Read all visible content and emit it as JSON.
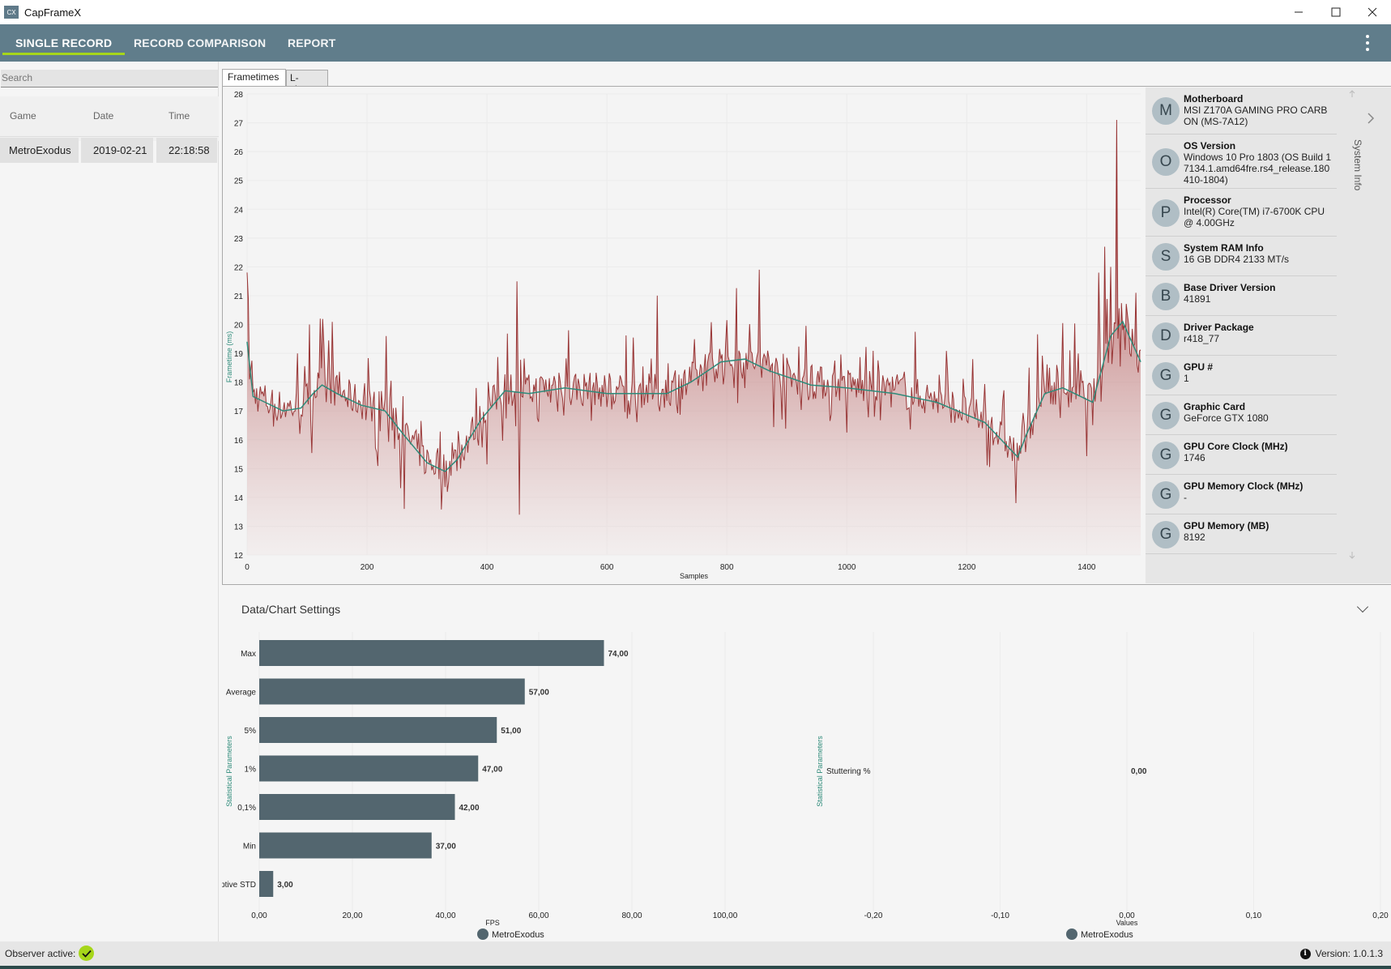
{
  "window": {
    "title": "CapFrameX",
    "icon_text": "CX",
    "controls": [
      "minimize-icon",
      "maximize-icon",
      "close-icon"
    ]
  },
  "nav": {
    "tabs": [
      {
        "label": "SINGLE RECORD",
        "active": true
      },
      {
        "label": "RECORD COMPARISON",
        "active": false
      },
      {
        "label": "REPORT",
        "active": false
      }
    ],
    "menu_icon": "kebab-menu-icon",
    "accent": "#a6d61a",
    "bar_color": "#607d8b"
  },
  "records": {
    "search_placeholder": "Search",
    "columns": [
      "Game",
      "Date",
      "Time"
    ],
    "rows": [
      {
        "game": "MetroExodus",
        "date": "2019-02-21",
        "time": "22:18:58"
      }
    ]
  },
  "chart_tabs": [
    {
      "label": "Frametimes",
      "active": true
    },
    {
      "label": "L-shape",
      "active": false
    }
  ],
  "system_info": {
    "rail_label": "System Info",
    "items": [
      {
        "initial": "M",
        "label": "Motherboard",
        "value": "MSI Z170A GAMING PRO CARBON (MS-7A12)"
      },
      {
        "initial": "O",
        "label": "OS Version",
        "value": "Windows 10 Pro 1803 (OS Build 17134.1.amd64fre.rs4_release.180410-1804)"
      },
      {
        "initial": "P",
        "label": "Processor",
        "value": "Intel(R) Core(TM) i7-6700K CPU @ 4.00GHz"
      },
      {
        "initial": "S",
        "label": "System RAM Info",
        "value": "16 GB DDR4 2133 MT/s"
      },
      {
        "initial": "B",
        "label": "Base Driver Version",
        "value": "41891"
      },
      {
        "initial": "D",
        "label": "Driver Package",
        "value": "r418_77"
      },
      {
        "initial": "G",
        "label": "GPU #",
        "value": "1"
      },
      {
        "initial": "G",
        "label": "Graphic Card",
        "value": "GeForce GTX 1080"
      },
      {
        "initial": "G",
        "label": "GPU Core Clock (MHz)",
        "value": "1746"
      },
      {
        "initial": "G",
        "label": "GPU Memory Clock (MHz)",
        "value": "-"
      },
      {
        "initial": "G",
        "label": "GPU Memory (MB)",
        "value": "8192"
      }
    ]
  },
  "settings": {
    "title": "Data/Chart Settings"
  },
  "status": {
    "observer_label": "Observer active:",
    "version_label": "Version: 1.0.1.3"
  },
  "chart_data": [
    {
      "type": "line",
      "title": "Frametimes",
      "xlabel": "Samples",
      "ylabel": "Frametime (ms)",
      "xlim": [
        0,
        1490
      ],
      "ylim": [
        12,
        28
      ],
      "xticks": [
        0,
        200,
        400,
        600,
        800,
        1000,
        1200,
        1400
      ],
      "yticks": [
        12,
        13,
        14,
        15,
        16,
        17,
        18,
        19,
        20,
        21,
        22,
        23,
        24,
        25,
        26,
        27,
        28
      ],
      "grid": true,
      "series": [
        {
          "name": "Frametime",
          "color": "#8b1a1a",
          "style": "noisy line with gradient area fill",
          "trend_points": [
            [
              0,
              19.4
            ],
            [
              10,
              17.5
            ],
            [
              30,
              17.3
            ],
            [
              60,
              17.0
            ],
            [
              90,
              17.1
            ],
            [
              110,
              17.6
            ],
            [
              125,
              17.9
            ],
            [
              150,
              17.6
            ],
            [
              190,
              17.2
            ],
            [
              230,
              17.0
            ],
            [
              260,
              16.2
            ],
            [
              300,
              15.2
            ],
            [
              330,
              14.9
            ],
            [
              350,
              15.3
            ],
            [
              390,
              16.7
            ],
            [
              430,
              17.7
            ],
            [
              470,
              17.6
            ],
            [
              530,
              17.8
            ],
            [
              600,
              17.6
            ],
            [
              700,
              17.6
            ],
            [
              740,
              18.0
            ],
            [
              790,
              18.7
            ],
            [
              830,
              18.8
            ],
            [
              870,
              18.4
            ],
            [
              940,
              17.9
            ],
            [
              1000,
              17.8
            ],
            [
              1080,
              17.6
            ],
            [
              1150,
              17.3
            ],
            [
              1230,
              16.6
            ],
            [
              1285,
              15.4
            ],
            [
              1300,
              16.2
            ],
            [
              1330,
              17.6
            ],
            [
              1360,
              17.8
            ],
            [
              1410,
              17.3
            ],
            [
              1440,
              19.6
            ],
            [
              1460,
              20.1
            ],
            [
              1490,
              18.7
            ]
          ],
          "spikes": [
            [
              3,
              20.9
            ],
            [
              105,
              20.0
            ],
            [
              232,
              19.6
            ],
            [
              450,
              21.5
            ],
            [
              685,
              21.0
            ],
            [
              855,
              21.9
            ],
            [
              1451,
              27.1
            ],
            [
              1430,
              22.7
            ],
            [
              1440,
              22.0
            ],
            [
              1420,
              21.8
            ],
            [
              455,
              13.4
            ],
            [
              262,
              13.6
            ],
            [
              1283,
              13.8
            ]
          ]
        },
        {
          "name": "Moving average",
          "color": "#2e8b7a",
          "points": [
            [
              0,
              19.4
            ],
            [
              10,
              17.5
            ],
            [
              30,
              17.3
            ],
            [
              60,
              17.0
            ],
            [
              90,
              17.1
            ],
            [
              110,
              17.6
            ],
            [
              125,
              17.9
            ],
            [
              150,
              17.6
            ],
            [
              190,
              17.2
            ],
            [
              230,
              17.0
            ],
            [
              260,
              16.2
            ],
            [
              300,
              15.2
            ],
            [
              330,
              14.9
            ],
            [
              350,
              15.3
            ],
            [
              390,
              16.7
            ],
            [
              430,
              17.7
            ],
            [
              470,
              17.6
            ],
            [
              530,
              17.8
            ],
            [
              600,
              17.6
            ],
            [
              700,
              17.6
            ],
            [
              740,
              18.0
            ],
            [
              790,
              18.7
            ],
            [
              830,
              18.8
            ],
            [
              870,
              18.4
            ],
            [
              940,
              17.9
            ],
            [
              1000,
              17.8
            ],
            [
              1080,
              17.6
            ],
            [
              1150,
              17.3
            ],
            [
              1230,
              16.6
            ],
            [
              1285,
              15.4
            ],
            [
              1300,
              16.2
            ],
            [
              1330,
              17.6
            ],
            [
              1360,
              17.8
            ],
            [
              1410,
              17.3
            ],
            [
              1440,
              19.6
            ],
            [
              1460,
              20.1
            ],
            [
              1490,
              18.7
            ]
          ]
        }
      ]
    },
    {
      "type": "bar",
      "orientation": "horizontal",
      "title": "",
      "xlabel": "FPS",
      "ylabel": "Statistical Parameters",
      "categories": [
        "Max",
        "Average",
        "5%",
        "1%",
        "0,1%",
        "Min",
        "Adaptive STD"
      ],
      "values": [
        74.0,
        57.0,
        51.0,
        47.0,
        42.0,
        37.0,
        3.0
      ],
      "value_labels": [
        "74,00",
        "57,00",
        "51,00",
        "47,00",
        "42,00",
        "37,00",
        "3,00"
      ],
      "xlim": [
        0,
        100
      ],
      "xticks": [
        "0,00",
        "20,00",
        "40,00",
        "60,00",
        "80,00",
        "100,00"
      ],
      "legend": [
        "MetroExodus"
      ],
      "legend_position": "bottom",
      "color": "#53666f"
    },
    {
      "type": "bar",
      "orientation": "horizontal",
      "title": "",
      "xlabel": "Values",
      "ylabel": "Statistical Parameters",
      "categories": [
        "Stuttering %"
      ],
      "values": [
        0.0
      ],
      "value_labels": [
        "0,00"
      ],
      "xlim": [
        -0.2,
        0.2
      ],
      "xticks": [
        "-0,20",
        "-0,10",
        "0,00",
        "0,10",
        "0,20"
      ],
      "legend": [
        "MetroExodus"
      ],
      "legend_position": "bottom",
      "color": "#53666f"
    }
  ]
}
